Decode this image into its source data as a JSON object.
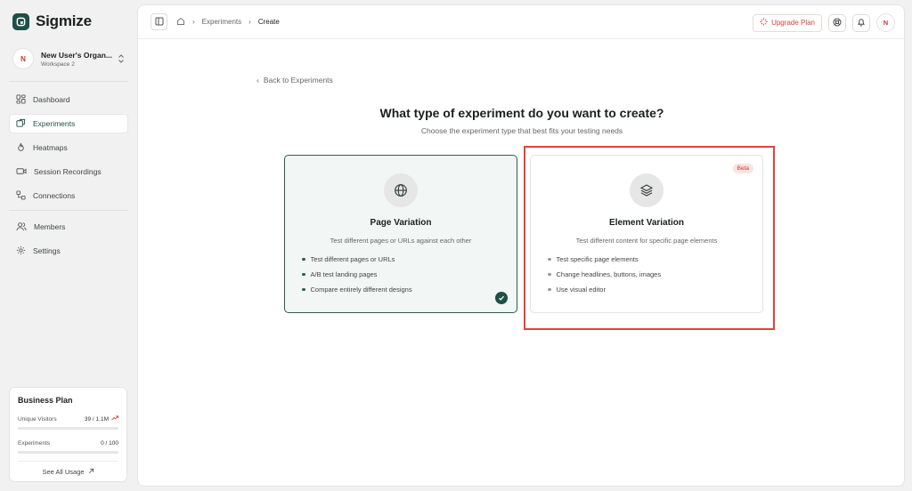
{
  "brand": {
    "name": "Sigmize"
  },
  "org": {
    "initial": "N",
    "name": "New User's Organ...",
    "workspace": "Workspace 2"
  },
  "sidebar": {
    "items": [
      {
        "label": "Dashboard",
        "icon": "dashboard-icon"
      },
      {
        "label": "Experiments",
        "icon": "experiments-icon",
        "active": true
      },
      {
        "label": "Heatmaps",
        "icon": "flame-icon"
      },
      {
        "label": "Session Recordings",
        "icon": "video-icon"
      },
      {
        "label": "Connections",
        "icon": "connections-icon"
      }
    ],
    "secondary": [
      {
        "label": "Members",
        "icon": "users-icon"
      },
      {
        "label": "Settings",
        "icon": "gear-icon"
      }
    ]
  },
  "plan": {
    "title": "Business Plan",
    "visitors_label": "Unique Visitors",
    "visitors_value": "39 / 1.1M",
    "visitors_progress": 0.0,
    "experiments_label": "Experiments",
    "experiments_value": "0 / 100",
    "experiments_progress": 0.0,
    "see_all": "See All Usage"
  },
  "topbar": {
    "breadcrumb": [
      "Experiments",
      "Create"
    ],
    "upgrade_label": "Upgrade Plan",
    "user_initial": "N"
  },
  "page": {
    "back_label": "Back to Experiments",
    "title": "What type of experiment do you want to create?",
    "subtitle": "Choose the experiment type that best fits your testing needs"
  },
  "cards": {
    "page_variation": {
      "title": "Page Variation",
      "description": "Test different pages or URLs against each other",
      "features": [
        "Test different pages or URLs",
        "A/B test landing pages",
        "Compare entirely different designs"
      ],
      "selected": true,
      "icon": "globe-icon"
    },
    "element_variation": {
      "title": "Element Variation",
      "description": "Test different content for specific page elements",
      "features": [
        "Test specific page elements",
        "Change headlines, buttons, images",
        "Use visual editor"
      ],
      "badge": "Beta",
      "selected": false,
      "icon": "layers-icon"
    }
  },
  "colors": {
    "accent": "#1f4f46",
    "danger": "#e4433a",
    "badge_bg": "#fbe3e1"
  }
}
